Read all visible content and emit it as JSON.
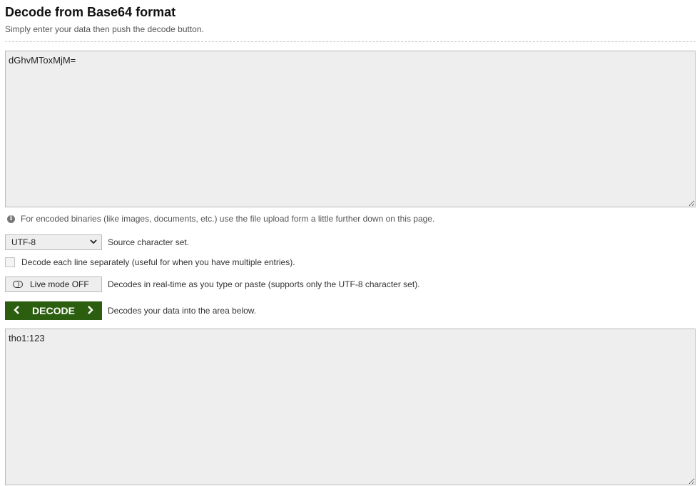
{
  "header": {
    "title": "Decode from Base64 format",
    "subtitle": "Simply enter your data then push the decode button."
  },
  "input": {
    "value": "dGhvMToxMjM="
  },
  "info": {
    "text": "For encoded binaries (like images, documents, etc.) use the file upload form a little further down on this page."
  },
  "charset": {
    "selected": "UTF-8",
    "label": "Source character set."
  },
  "line_option": {
    "checked": false,
    "label": "Decode each line separately (useful for when you have multiple entries)."
  },
  "live_mode": {
    "button_label": "Live mode OFF",
    "description": "Decodes in real-time as you type or paste (supports only the UTF-8 character set)."
  },
  "decode": {
    "button_label": "DECODE",
    "description": "Decodes your data into the area below."
  },
  "output": {
    "value": "tho1:123"
  },
  "colors": {
    "decode_button": "#2b5f0f",
    "textarea_bg": "#eeeeee"
  },
  "icons": {
    "info": "info-icon",
    "toggle": "toggle-off-icon",
    "left_arrow": "chevron-left-icon",
    "right_arrow": "chevron-right-icon",
    "dropdown": "chevron-down-icon"
  }
}
